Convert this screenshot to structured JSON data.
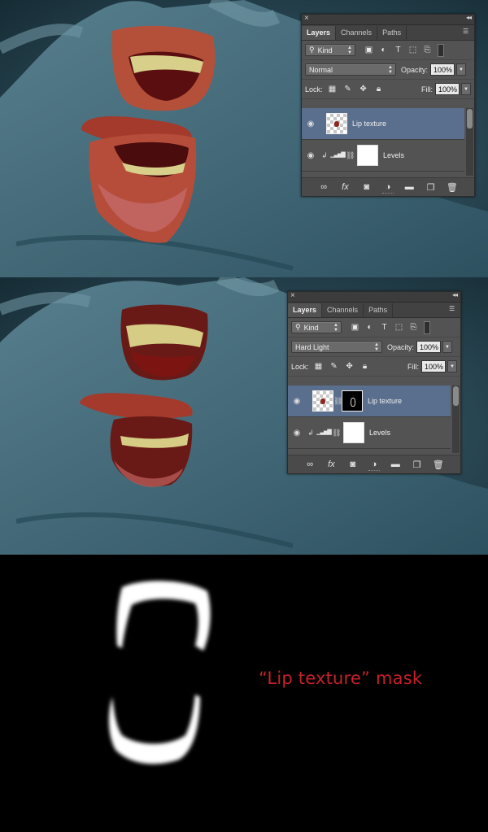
{
  "colors": {
    "background_teal": "#2c4b58",
    "panel_bg": "#535353",
    "selected_layer": "#5a6f8e",
    "caption_red": "#c8202a"
  },
  "panels": [
    {
      "tabs": [
        "Layers",
        "Channels",
        "Paths"
      ],
      "active_tab": "Layers",
      "filter_kind": "Kind",
      "blend_mode": "Normal",
      "opacity_label": "Opacity:",
      "opacity_value": "100%",
      "lock_label": "Lock:",
      "fill_label": "Fill:",
      "fill_value": "100%",
      "layers": [
        {
          "name": "Lip texture",
          "selected": true,
          "has_mask": false
        },
        {
          "name": "Levels",
          "selected": false,
          "adjustment": true
        }
      ]
    },
    {
      "tabs": [
        "Layers",
        "Channels",
        "Paths"
      ],
      "active_tab": "Layers",
      "filter_kind": "Kind",
      "blend_mode": "Hard Light",
      "opacity_label": "Opacity:",
      "opacity_value": "100%",
      "lock_label": "Lock:",
      "fill_label": "Fill:",
      "fill_value": "100%",
      "layers": [
        {
          "name": "Lip texture",
          "selected": true,
          "has_mask": true
        },
        {
          "name": "Levels",
          "selected": false,
          "adjustment": true
        }
      ]
    }
  ],
  "icons": {
    "close": "×",
    "collapse": "◂◂",
    "menu": "☰",
    "search": "⚲",
    "eye": "◉",
    "chain": "⛓",
    "clip": "↲"
  },
  "caption": "“Lip texture” mask"
}
